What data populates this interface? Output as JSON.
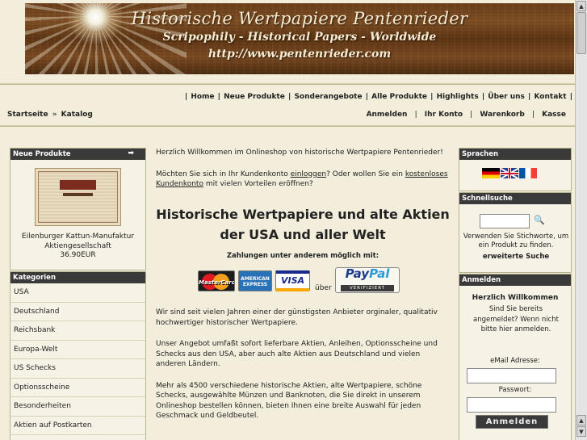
{
  "banner": {
    "title": "Historische Wertpapiere Pentenrieder",
    "subtitle": "Scripophily - Historical Papers - Worldwide",
    "url": "http://www.pentenrieder.com"
  },
  "topnav": {
    "items": [
      "Home",
      "Neue Produkte",
      "Sonderangebote",
      "Alle Produkte",
      "Highlights",
      "Über uns",
      "Kontakt"
    ]
  },
  "breadcrumb": {
    "home": "Startseite",
    "separator": "»",
    "current": "Katalog"
  },
  "accountnav": {
    "items": [
      "Anmelden",
      "Ihr Konto",
      "Warenkorb",
      "Kasse"
    ]
  },
  "new_products": {
    "heading": "Neue Produkte",
    "product_name": "Eilenburger Kattun-Manufaktur Aktiengesellschaft",
    "price": "36.90EUR"
  },
  "categories": {
    "heading": "Kategorien",
    "items": [
      "USA",
      "Deutschland",
      "Reichsbank",
      "Europa-Welt",
      "US Schecks",
      "Optionsscheine",
      "Besonderheiten",
      "Aktien auf Postkarten"
    ]
  },
  "languages": {
    "heading": "Sprachen",
    "flags": [
      "flag-de-icon",
      "flag-uk-icon",
      "flag-fr-icon"
    ]
  },
  "quick_search": {
    "heading": "Schnellsuche",
    "help": "Verwenden Sie Stichworte, um ein Produkt zu finden.",
    "advanced": "erweiterte Suche",
    "search_value": ""
  },
  "login": {
    "heading": "Anmelden",
    "welcome": "Herzlich Willkommen",
    "question": "Sind Sie bereits angemeldet? Wenn nicht bitte hier anmelden.",
    "email_label": "eMail Adresse:",
    "password_label": "Passwort:",
    "button": "Anmelden",
    "email_value": "",
    "password_value": ""
  },
  "center": {
    "welcome": "Herzlich Willkommen im Onlineshop von historische Wertpapiere Pentenrieder!",
    "login_q_pre": "Möchten Sie sich in Ihr Kundenkonto ",
    "login_link": "einloggen",
    "login_q_mid": "? Oder wollen Sie ein ",
    "signup_link": "kostenloses Kundenkonto",
    "login_q_post": " mit vielen Vorteilen eröffnen?",
    "headline": "Historische Wertpapiere und alte Aktien der USA und aller Welt",
    "payment_title": "Zahlungen unter anderem möglich mit:",
    "payment": {
      "mastercard": "MasterCard",
      "amex": "AMERICAN EXPRESS",
      "visa": "VISA",
      "ueber": "über",
      "paypal_a": "Pay",
      "paypal_b": "Pal",
      "paypal_verified": "VERIFIZIERT"
    },
    "p1": "Wir sind seit vielen Jahren einer der günstigsten Anbieter orginaler, qualitativ hochwertiger historischer Wertpapiere.",
    "p2": "Unser Angebot umfaßt sofort lieferbare Aktien, Anleihen, Optionsscheine und Schecks aus den USA, aber auch alte Aktien aus Deutschland und vielen anderen Ländern.",
    "p3": "Mehr als 4500 verschiedene historische Aktien, alte Wertpapiere, schöne Schecks, ausgewählte Münzen und Banknoten, die Sie direkt in unserem Onlineshop bestellen können, bieten Ihnen eine breite Auswahl für jeden Geschmack und Geldbeutel."
  }
}
